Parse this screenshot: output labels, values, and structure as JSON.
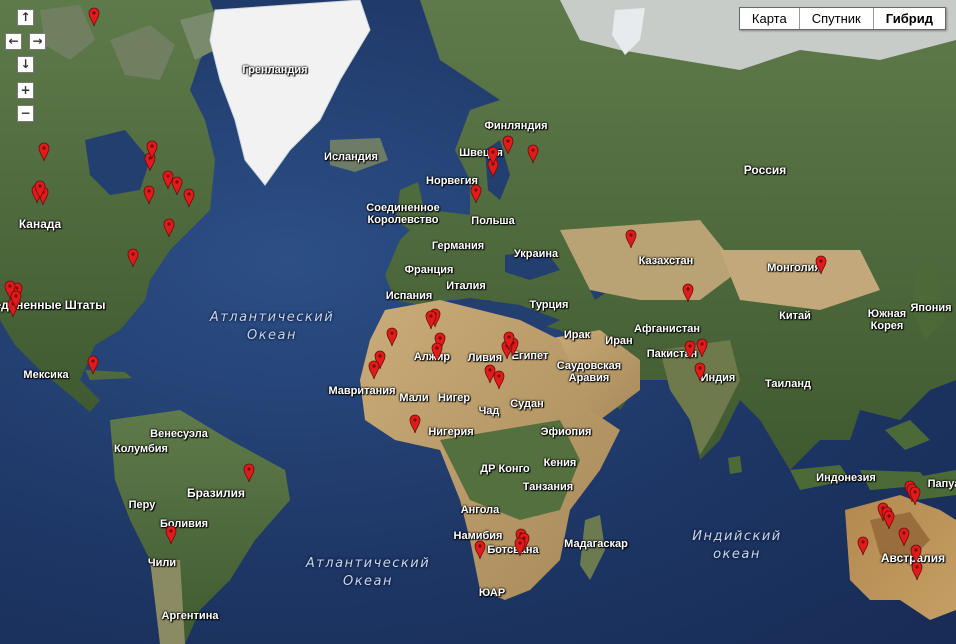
{
  "map_type_buttons": [
    {
      "label": "Карта",
      "active": false
    },
    {
      "label": "Спутник",
      "active": false
    },
    {
      "label": "Гибрид",
      "active": true
    }
  ],
  "nav_icons": [
    "pan-up-icon",
    "pan-left-icon",
    "pan-right-icon",
    "pan-down-icon",
    "zoom-in-icon",
    "zoom-out-icon"
  ],
  "labels": {
    "greenland": "Гренландия",
    "iceland": "Исландия",
    "finland": "Финляндия",
    "sweden": "Швеция",
    "norway": "Норвегия",
    "uk": "Соединенное Королевство",
    "poland": "Польша",
    "germany": "Германия",
    "ukraine": "Украина",
    "france": "Франция",
    "spain": "Испания",
    "italy": "Италия",
    "turkey": "Турция",
    "russia": "Россия",
    "kazakhstan": "Казахстан",
    "mongolia": "Монголия",
    "china": "Китай",
    "south_korea": "Южная Корея",
    "japan": "Япония",
    "canada": "Канада",
    "usa": "Соединенные Штаты",
    "mexico": "Мексика",
    "algeria": "Алжир",
    "libya": "Ливия",
    "egypt": "Египет",
    "iraq": "Ирак",
    "iran": "Иран",
    "afghanistan": "Афганистан",
    "pakistan": "Пакистан",
    "saudi_arabia": "Саудовская Аравия",
    "india": "Индия",
    "thailand": "Таиланд",
    "mauritania": "Мавритания",
    "mali": "Мали",
    "niger": "Нигер",
    "chad": "Чад",
    "sudan": "Судан",
    "ethiopia": "Эфиопия",
    "nigeria": "Нигерия",
    "drc": "ДР Конго",
    "kenya": "Кения",
    "tanzania": "Танзания",
    "angola": "Ангола",
    "namibia": "Намибия",
    "botswana": "Ботсвана",
    "madagascar": "Мадагаскар",
    "south_africa": "ЮАР",
    "indonesia": "Индонезия",
    "png": "Папуа",
    "australia": "Австралия",
    "venezuela": "Венесуэла",
    "colombia": "Колумбия",
    "brazil": "Бразилия",
    "peru": "Перу",
    "bolivia": "Боливия",
    "chile": "Чили",
    "argentina": "Аргентина"
  },
  "oceans": {
    "atlantic_north": {
      "line1": "Атлантический",
      "line2": "Океан"
    },
    "atlantic_south": {
      "line1": "Атлантический",
      "line2": "Океан"
    },
    "indian": {
      "line1": "Индийский",
      "line2": "океан"
    }
  },
  "colors": {
    "ocean": "#1e3766",
    "land_green": "#4f6b3c",
    "desert": "#b89a66",
    "ice": "#f4f4f4",
    "marker": "#e11b1b"
  },
  "marker_count": 58
}
